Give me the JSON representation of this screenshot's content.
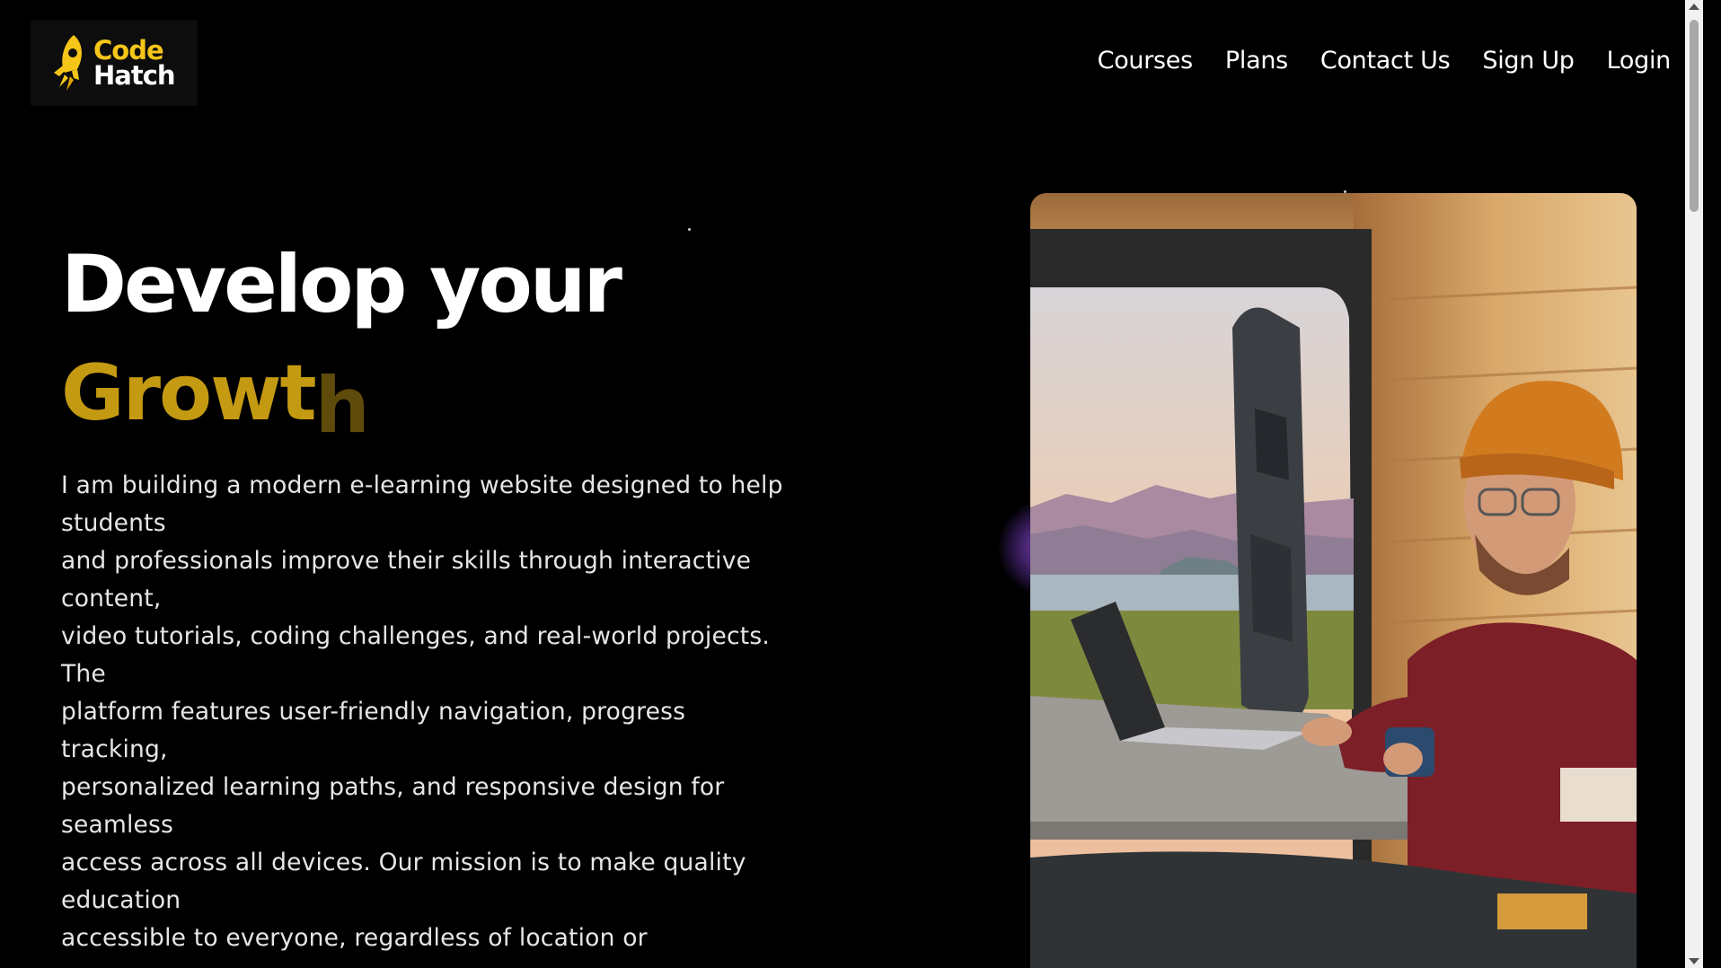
{
  "brand": {
    "logo_line1": "Code",
    "logo_line2": "Hatch",
    "accent_color": "#f5c518"
  },
  "nav": {
    "items": [
      {
        "label": "Courses"
      },
      {
        "label": "Plans"
      },
      {
        "label": "Contact Us"
      },
      {
        "label": "Sign Up"
      },
      {
        "label": "Login"
      }
    ]
  },
  "hero": {
    "title": "Develop your",
    "accent_main": "Growt",
    "accent_fade": "h",
    "description_lines": [
      "I am building a modern e-learning website designed to help",
      "students",
      "and professionals improve their skills through interactive",
      "content,",
      "video tutorials, coding challenges, and real-world projects.",
      "The",
      "platform features user-friendly navigation, progress",
      "tracking,",
      "personalized learning paths, and responsive design for",
      "seamless",
      "access across all devices. Our mission is to make quality",
      "education",
      "accessible to everyone, regardless of location or"
    ],
    "image_icon": "man-with-laptop-in-van-photo"
  }
}
